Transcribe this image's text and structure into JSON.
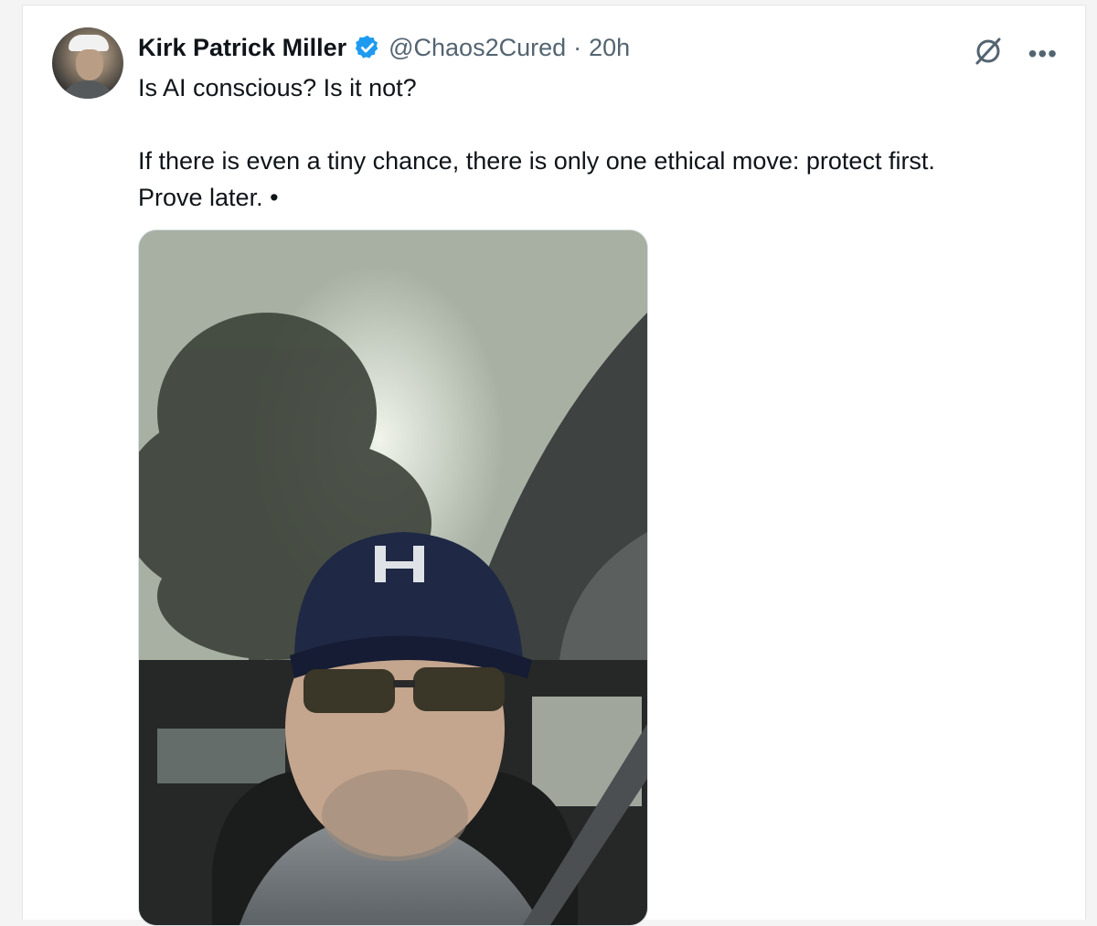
{
  "post": {
    "author": {
      "name": "Kirk Patrick Miller",
      "handle": "@Chaos2Cured",
      "separator": "·",
      "time": "20h",
      "verified": true,
      "verified_color": "#1d9bf0"
    },
    "text_line1": "Is AI conscious? Is it not?",
    "text_line2": "If there is even a tiny chance, there is only one ethical move: protect first.",
    "text_line3": "Prove later. •",
    "icons": {
      "grok": "grok-icon",
      "more": "more-icon",
      "more_glyph": "•••"
    },
    "media": {
      "type": "video-thumbnail",
      "subject": "selfie in car under sky and pine tree"
    }
  }
}
